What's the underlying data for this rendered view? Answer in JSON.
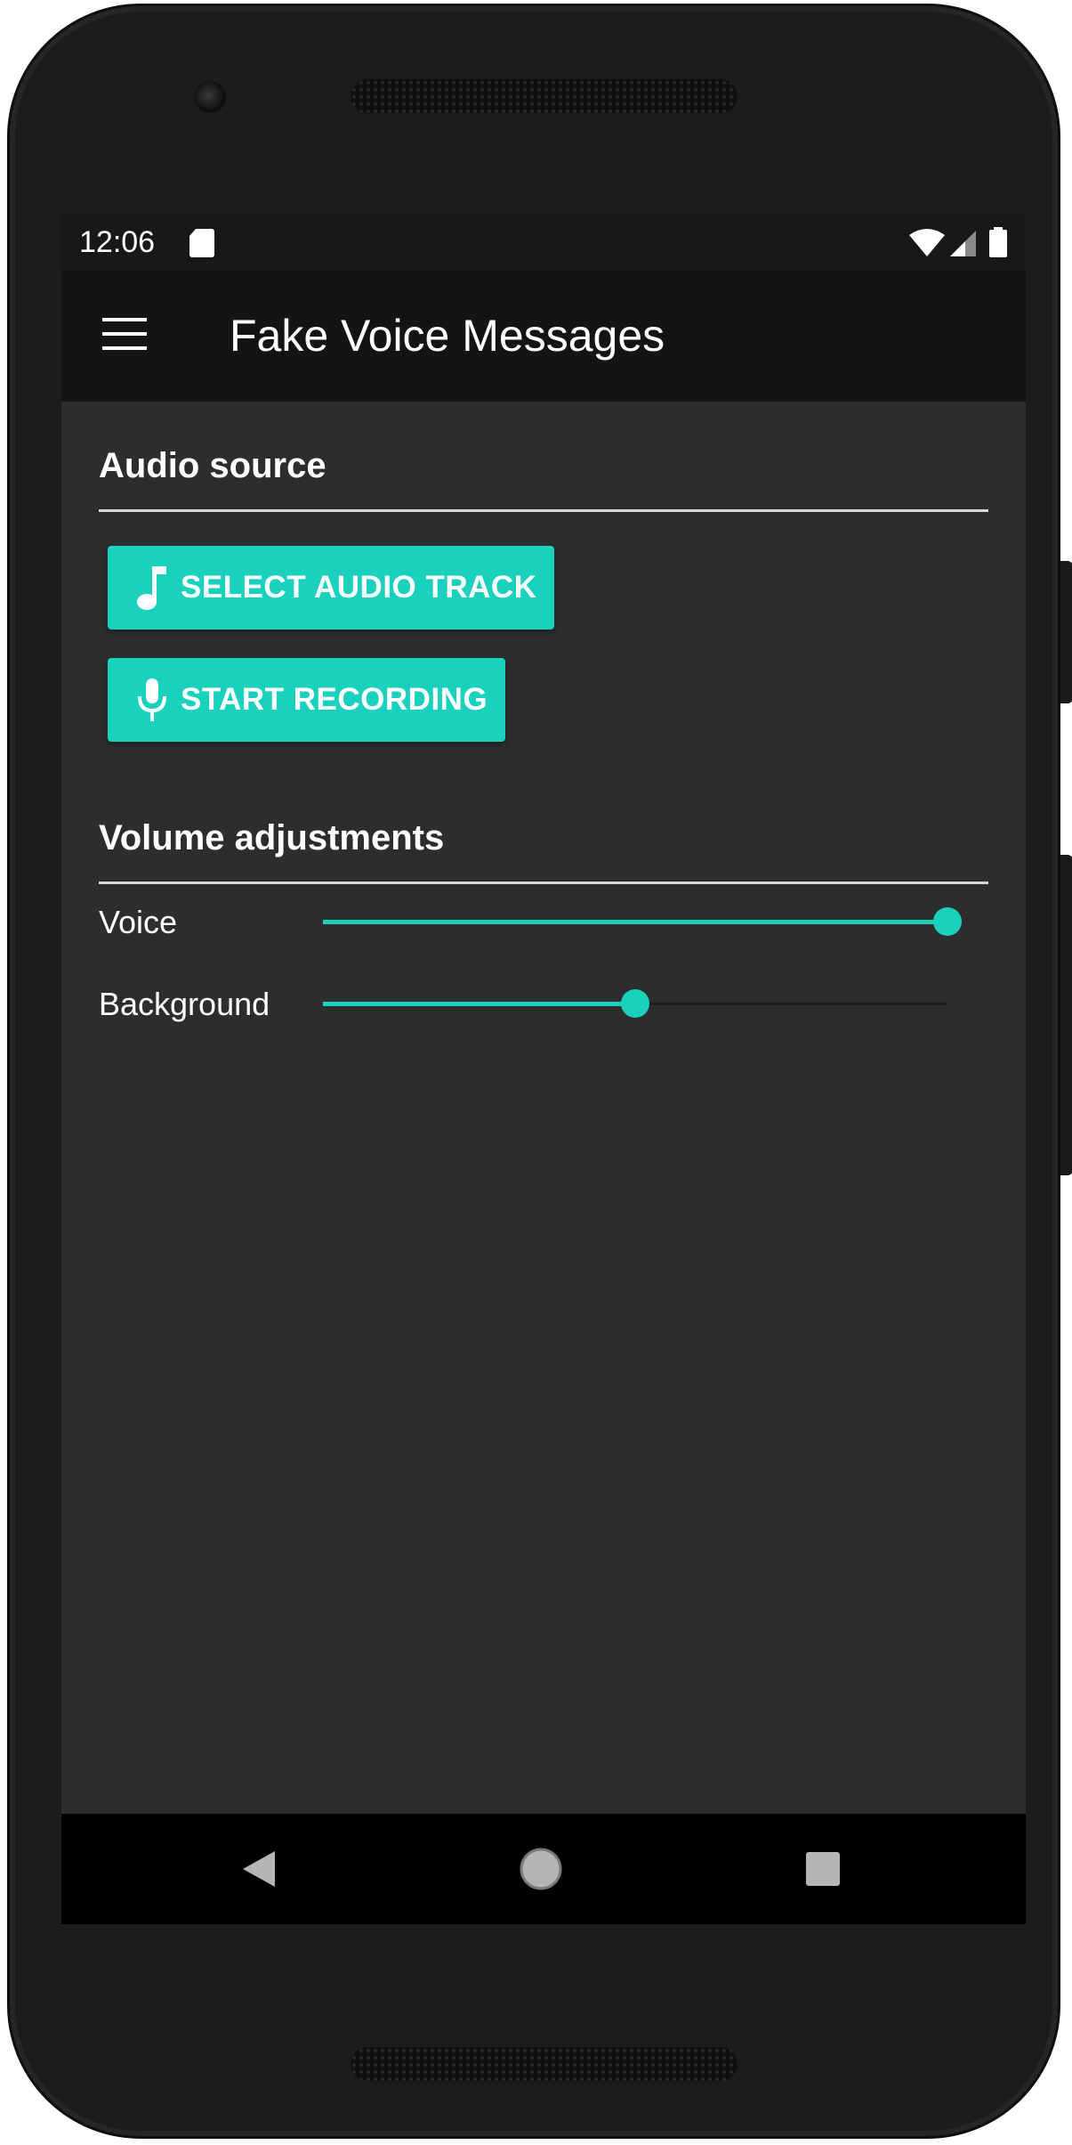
{
  "status_bar": {
    "time": "12:06",
    "icons": [
      "sd-card-icon",
      "wifi-icon",
      "cell-signal-icon",
      "battery-icon"
    ]
  },
  "app_bar": {
    "title": "Fake Voice Messages",
    "menu_icon": "hamburger-menu-icon"
  },
  "audio_source": {
    "title": "Audio source",
    "buttons": [
      {
        "label": "SELECT AUDIO TRACK",
        "icon": "music-note-icon"
      },
      {
        "label": "START RECORDING",
        "icon": "microphone-icon"
      }
    ]
  },
  "volume": {
    "title": "Volume adjustments",
    "sliders": [
      {
        "label": "Voice",
        "value": 1.0
      },
      {
        "label": "Background",
        "value": 0.5
      }
    ]
  },
  "nav_bar": {
    "buttons": [
      "back-icon",
      "home-icon",
      "recents-icon"
    ]
  },
  "colors": {
    "accent": "#1ad1bd",
    "screen_bg": "#2d2d2d",
    "app_bar_bg": "#141414",
    "status_bar_bg": "#181818"
  }
}
